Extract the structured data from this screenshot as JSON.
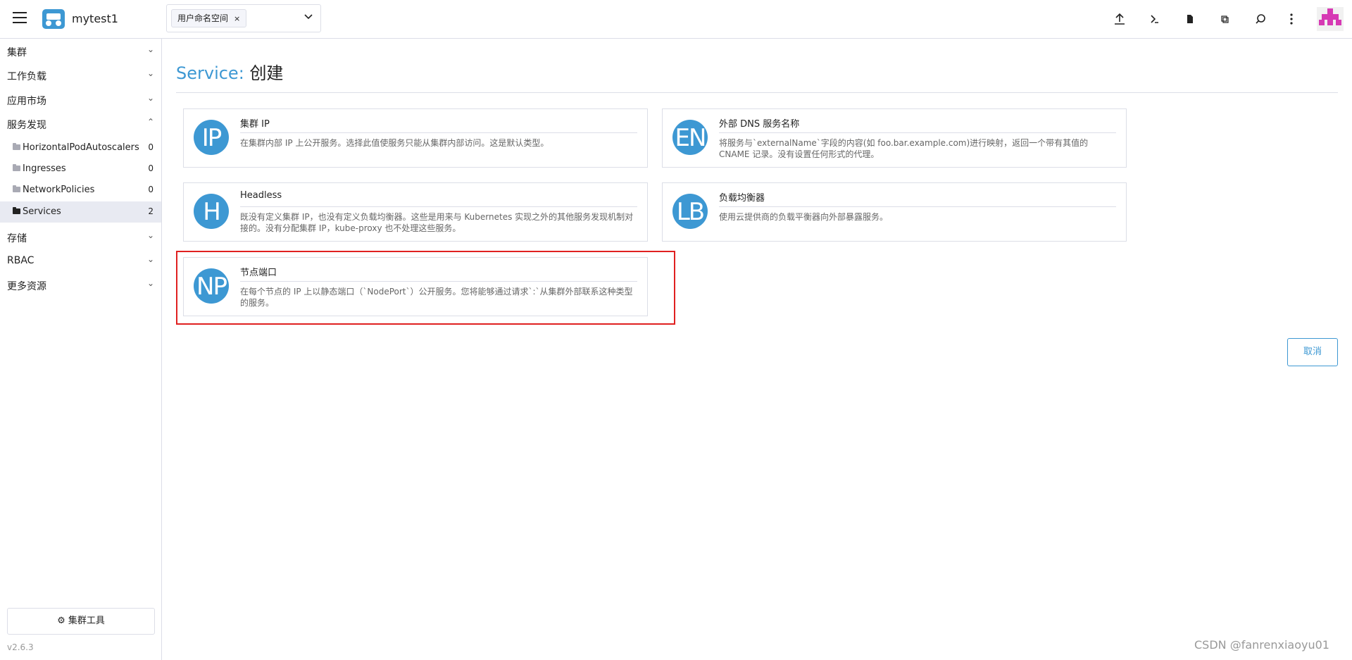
{
  "header": {
    "cluster_name": "mytest1",
    "namespace_chip": "用户命名空间",
    "namespace_chip_remove": "×",
    "icons": [
      "upload-icon",
      "terminal-icon",
      "file-icon",
      "copy-icon",
      "search-icon",
      "more-vertical-icon"
    ]
  },
  "sidebar": {
    "groups": [
      {
        "label": "集群",
        "chevron": "⌄"
      },
      {
        "label": "工作负载",
        "chevron": "⌄"
      },
      {
        "label": "应用市场",
        "chevron": "⌄"
      },
      {
        "label": "服务发现",
        "chevron": "⌃"
      }
    ],
    "subitems": [
      {
        "label": "HorizontalPodAutoscalers",
        "count": "0"
      },
      {
        "label": "Ingresses",
        "count": "0"
      },
      {
        "label": "NetworkPolicies",
        "count": "0"
      },
      {
        "label": "Services",
        "count": "2"
      }
    ],
    "groups_after": [
      {
        "label": "存储",
        "chevron": "⌄"
      },
      {
        "label": "RBAC",
        "chevron": "⌄"
      },
      {
        "label": "更多资源",
        "chevron": "⌄"
      }
    ],
    "tools_label": "集群工具",
    "tools_icon": "⚙",
    "version": "v2.6.3"
  },
  "main": {
    "title_prefix": "Service:",
    "title_action": "创建",
    "cards": [
      {
        "abbr": "IP",
        "title": "集群 IP",
        "desc": "在集群内部 IP 上公开服务。选择此值使服务只能从集群内部访问。这是默认类型。"
      },
      {
        "abbr": "EN",
        "title": "外部 DNS 服务名称",
        "desc": "将服务与`externalName`字段的内容(如 foo.bar.example.com)进行映射，返回一个带有其值的 CNAME 记录。没有设置任何形式的代理。"
      },
      {
        "abbr": "H",
        "title": "Headless",
        "desc": "既没有定义集群 IP，也没有定义负载均衡器。这些是用来与 Kubernetes 实现之外的其他服务发现机制对接的。没有分配集群 IP，kube-proxy 也不处理这些服务。"
      },
      {
        "abbr": "LB",
        "title": "负载均衡器",
        "desc": "使用云提供商的负载平衡器向外部暴露服务。"
      },
      {
        "abbr": "NP",
        "title": "节点端口",
        "desc": "在每个节点的 IP 上以静态端口（`NodePort`）公开服务。您将能够通过请求`:`从集群外部联系这种类型的服务。"
      }
    ],
    "cancel_label": "取消"
  },
  "watermark": "CSDN @fanrenxiaoyu01",
  "colors": {
    "accent": "#3d98d3",
    "highlight": "#e02020"
  }
}
